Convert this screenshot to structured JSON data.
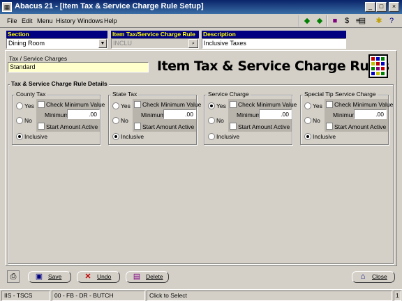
{
  "window": {
    "title": "Abacus 21 - [Item Tax & Service Charge Rule Setup]"
  },
  "menu": [
    "File",
    "Edit",
    "Menu",
    "History",
    "Windows",
    "Help"
  ],
  "header": {
    "section_label": "Section",
    "section_value": "Dining Room",
    "rule_label": "Item Tax/Service Charge Rule",
    "rule_value": "INCLU",
    "desc_label": "Description",
    "desc_value": "Inclusive Taxes"
  },
  "tax_charges": {
    "label": "Tax / Service Charges",
    "value": "Standard"
  },
  "banner": "Item Tax & Service Charge Rules",
  "details_title": "Tax & Service Charge Rule Details",
  "groups": [
    {
      "title": "County Tax",
      "yes": "Yes",
      "no": "No",
      "inclusive": "Inclusive",
      "selected": "inclusive",
      "check_min": "Check Minimum Value",
      "minimum_label": "Minimum",
      "minimum_value": ".00",
      "start_amount": "Start Amount Active"
    },
    {
      "title": "State Tax",
      "yes": "Yes",
      "no": "No",
      "inclusive": "Inclusive",
      "selected": "inclusive",
      "check_min": "Check Minimum Value",
      "minimum_label": "Minimum",
      "minimum_value": ".00",
      "start_amount": "Start Amount Active"
    },
    {
      "title": "Service Charge",
      "yes": "Yes",
      "no": "No",
      "inclusive": "Inclusive",
      "selected": "yes",
      "check_min": "Check Minimum Value",
      "minimum_label": "Minimum",
      "minimum_value": ".00",
      "start_amount": "Start Amount Active"
    },
    {
      "title": "Special Tip Service Charge",
      "yes": "Yes",
      "no": "No",
      "inclusive": "Inclusive",
      "selected": "inclusive",
      "check_min": "Check Minimum Value",
      "minimum_label": "Minimum",
      "minimum_value": ".00",
      "start_amount": "Start Amount Active"
    }
  ],
  "buttons": {
    "save": "Save",
    "undo": "Undo",
    "delete": "Delete",
    "close": "Close"
  },
  "status": {
    "system": "IIS - TSCS",
    "context": "00 - FB - DR - BUTCH",
    "hint": "Click to Select",
    "page": "1"
  },
  "colors": {
    "header_label_bg": "#000080",
    "header_label_fg": "#ffff00",
    "tax_field_bg": "#ffffcc"
  }
}
